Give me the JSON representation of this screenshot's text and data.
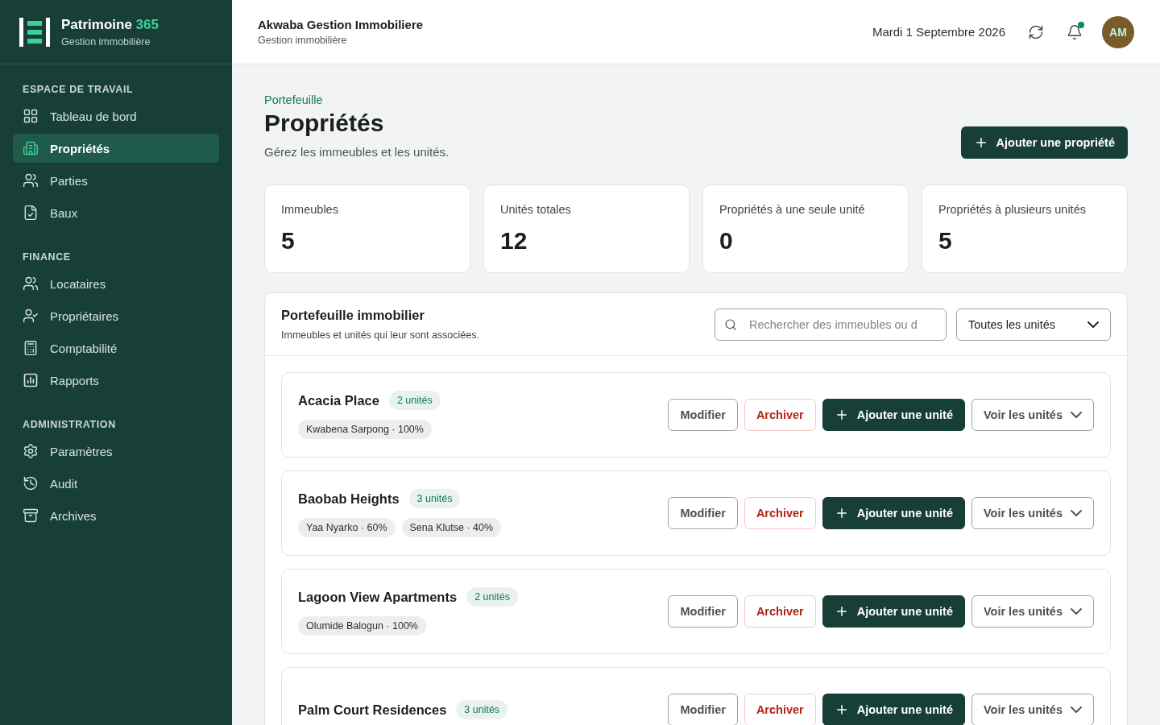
{
  "brand": {
    "name": "Patrimoine",
    "accent": "365",
    "subtitle": "Gestion immobilière"
  },
  "sidebar": {
    "sections": [
      {
        "title": "ESPACE DE TRAVAIL",
        "items": [
          {
            "label": "Tableau de bord",
            "selected": false
          },
          {
            "label": "Propriétés",
            "selected": true
          },
          {
            "label": "Parties",
            "selected": false
          },
          {
            "label": "Baux",
            "selected": false
          }
        ]
      },
      {
        "title": "FINANCE",
        "items": [
          {
            "label": "Locataires",
            "selected": false
          },
          {
            "label": "Propriétaires",
            "selected": false
          },
          {
            "label": "Comptabilité",
            "selected": false
          },
          {
            "label": "Rapports",
            "selected": false
          }
        ]
      },
      {
        "title": "ADMINISTRATION",
        "items": [
          {
            "label": "Paramètres",
            "selected": false
          },
          {
            "label": "Audit",
            "selected": false
          },
          {
            "label": "Archives",
            "selected": false
          }
        ]
      }
    ]
  },
  "header": {
    "company": "Akwaba Gestion Immobiliere",
    "subtitle": "Gestion immobilière",
    "date": "Mardi 1 Septembre 2026",
    "has_notification": true,
    "avatar": "AM"
  },
  "page": {
    "breadcrumb": "Portefeuille",
    "title": "Propriétés",
    "description": "Gérez les immeubles et les unités.",
    "primary_action": "Ajouter une propriété"
  },
  "stats": [
    {
      "label": "Immeubles",
      "value": "5"
    },
    {
      "label": "Unités totales",
      "value": "12"
    },
    {
      "label": "Propriétés à une seule unité",
      "value": "0"
    },
    {
      "label": "Propriétés à plusieurs unités",
      "value": "5"
    }
  ],
  "portfolio": {
    "title": "Portefeuille immobilier",
    "subtitle": "Immeubles et unités qui leur sont associées.",
    "search": {
      "placeholder": "Rechercher des immeubles ou d"
    },
    "filter": "Toutes les unités",
    "properties": [
      {
        "name": "Acacia Place",
        "units": "2 unités",
        "owners": [
          "Kwabena Sarpong · 100%"
        ],
        "actions": [
          {
            "kind": "outline",
            "label": "Modifier"
          },
          {
            "kind": "danger",
            "label": "Archiver"
          },
          {
            "kind": "primary",
            "label": "Ajouter une unité"
          },
          {
            "kind": "dropdown",
            "label": "Voir les unités"
          }
        ]
      },
      {
        "name": "Baobab Heights",
        "units": "3 unités",
        "owners": [
          "Yaa Nyarko · 60%",
          "Sena Klutse · 40%"
        ],
        "actions": [
          {
            "kind": "outline",
            "label": "Modifier"
          },
          {
            "kind": "danger",
            "label": "Archiver"
          },
          {
            "kind": "primary",
            "label": "Ajouter une unité"
          },
          {
            "kind": "dropdown",
            "label": "Voir les unités"
          }
        ]
      },
      {
        "name": "Lagoon View Apartments",
        "units": "2 unités",
        "owners": [
          "Olumide Balogun · 100%"
        ],
        "actions": [
          {
            "kind": "outline",
            "label": "Modifier"
          },
          {
            "kind": "danger",
            "label": "Archiver"
          },
          {
            "kind": "primary",
            "label": "Ajouter une unité"
          },
          {
            "kind": "dropdown",
            "label": "Voir les unités"
          }
        ]
      },
      {
        "name": "Palm Court Residences",
        "units": "3 unités",
        "actions": [
          {
            "kind": "outline",
            "label": "Modifier"
          },
          {
            "kind": "danger",
            "label": "Archiver"
          },
          {
            "kind": "primary",
            "label": "Ajouter une unité"
          },
          {
            "kind": "dropdown",
            "label": "Voir les unités"
          }
        ]
      }
    ]
  }
}
